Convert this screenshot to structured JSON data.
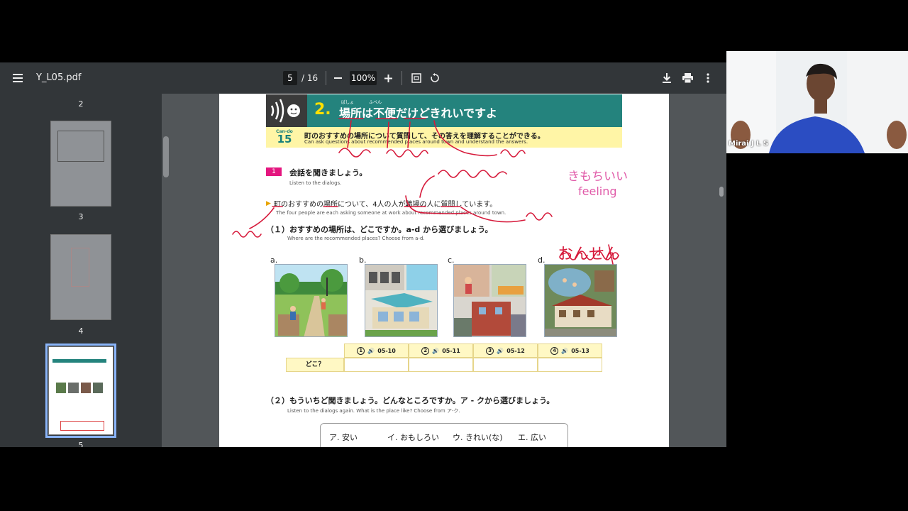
{
  "toolbar": {
    "filename": "Y_L05.pdf",
    "page_current": "5",
    "page_total": "/ 16",
    "zoom": "100%"
  },
  "sidebar": {
    "thumb_labels": [
      "2",
      "3",
      "4",
      "5"
    ]
  },
  "lesson": {
    "number": "2.",
    "title": "場所は不便だけどきれいですよ",
    "furigana": {
      "basho": "ばしょ",
      "fuben": "ふべん"
    },
    "cando_label": "Can-do",
    "cando_number": "15",
    "cando_ja": "町のおすすめの場所について質問して、その答えを理解することができる。",
    "cando_en": "Can ask questions about recommended places around town and understand the answers.",
    "section_num": "1",
    "section_title": "会話を聞きましょう。",
    "section_en": "Listen to the dialogs.",
    "intro_ja": "町のおすすめの場所について、4人の人が職場の人に質問しています。",
    "intro_en": "The four people are each asking someone at work about recommended places around town.",
    "q1_ja": "（１）おすすめの場所は、どこですか。a-d から選びましょう。",
    "q1_en": "Where are the recommended places? Choose from a-d.",
    "pictures": [
      "a.",
      "b.",
      "c.",
      "d."
    ],
    "table_heads": [
      {
        "n": "1",
        "code": "05-10"
      },
      {
        "n": "2",
        "code": "05-11"
      },
      {
        "n": "3",
        "code": "05-12"
      },
      {
        "n": "4",
        "code": "05-13"
      }
    ],
    "doko": "どこ？",
    "q2_ja": "（２）もういちど聞きましょう。どんなところですか。ア - クから選びましょう。",
    "q2_en": "Listen to the dialogs again. What is the place like? Choose from ア-ク.",
    "choices": [
      "ア. 安い",
      "イ. おもしろい",
      "ウ. きれい(な)",
      "エ. 広い"
    ]
  },
  "annotations": {
    "kimochi": "きもちいい",
    "feeling": "feeling",
    "onsen": "おんせん"
  },
  "webcam": {
    "name": "Mirai J L S"
  },
  "colors": {
    "header_teal": "#24837d",
    "cando_yellow": "#fff5a6",
    "ink_red": "#d6193a",
    "ink_pink": "#e05aa8"
  }
}
